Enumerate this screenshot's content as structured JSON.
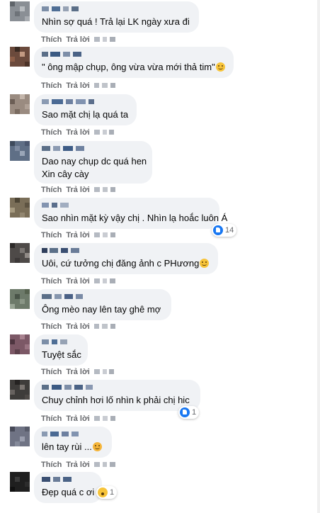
{
  "action_like": "Thích",
  "action_reply": "Trả lời",
  "comments": [
    {
      "text": "Nhìn sợ quá ! Trả lại LK ngày xưa đi",
      "emoji": "",
      "reaction": null
    },
    {
      "text": "\" ông mập chụp, ông vừa vừa mới thả tim\"",
      "emoji": "smile",
      "reaction": null
    },
    {
      "text": "Sao mặt chị lạ quá ta",
      "emoji": "",
      "reaction": null
    },
    {
      "text": "Dao nay chụp dc quá hen",
      "text2": "Xin cây cày",
      "emoji": "",
      "reaction": null
    },
    {
      "text": "Sao nhìn mặt kỳ vậy chị . Nhìn lạ hoắc luôn Á",
      "emoji": "",
      "reaction": {
        "icon": "like-icon",
        "count": "14"
      }
    },
    {
      "text": "Uôi, cứ tưởng chị đăng ảnh c PHương",
      "emoji": "grin",
      "reaction": null
    },
    {
      "text": "Ông mèo nay lên tay ghê mợ",
      "emoji": "",
      "reaction": null
    },
    {
      "text": "Tuyệt sắc",
      "emoji": "",
      "reaction": null
    },
    {
      "text": "Chuy chỉnh hơi lố nhìn k phải chị hic",
      "emoji": "",
      "reaction": {
        "icon": "like-icon",
        "count": "1"
      }
    },
    {
      "text": "lên tay rùi ...",
      "emoji": "kiss",
      "reaction": null
    },
    {
      "text": "Đẹp quá c ơi",
      "emoji": "",
      "reaction": {
        "icon": "wow-icon",
        "count": "1"
      }
    }
  ]
}
